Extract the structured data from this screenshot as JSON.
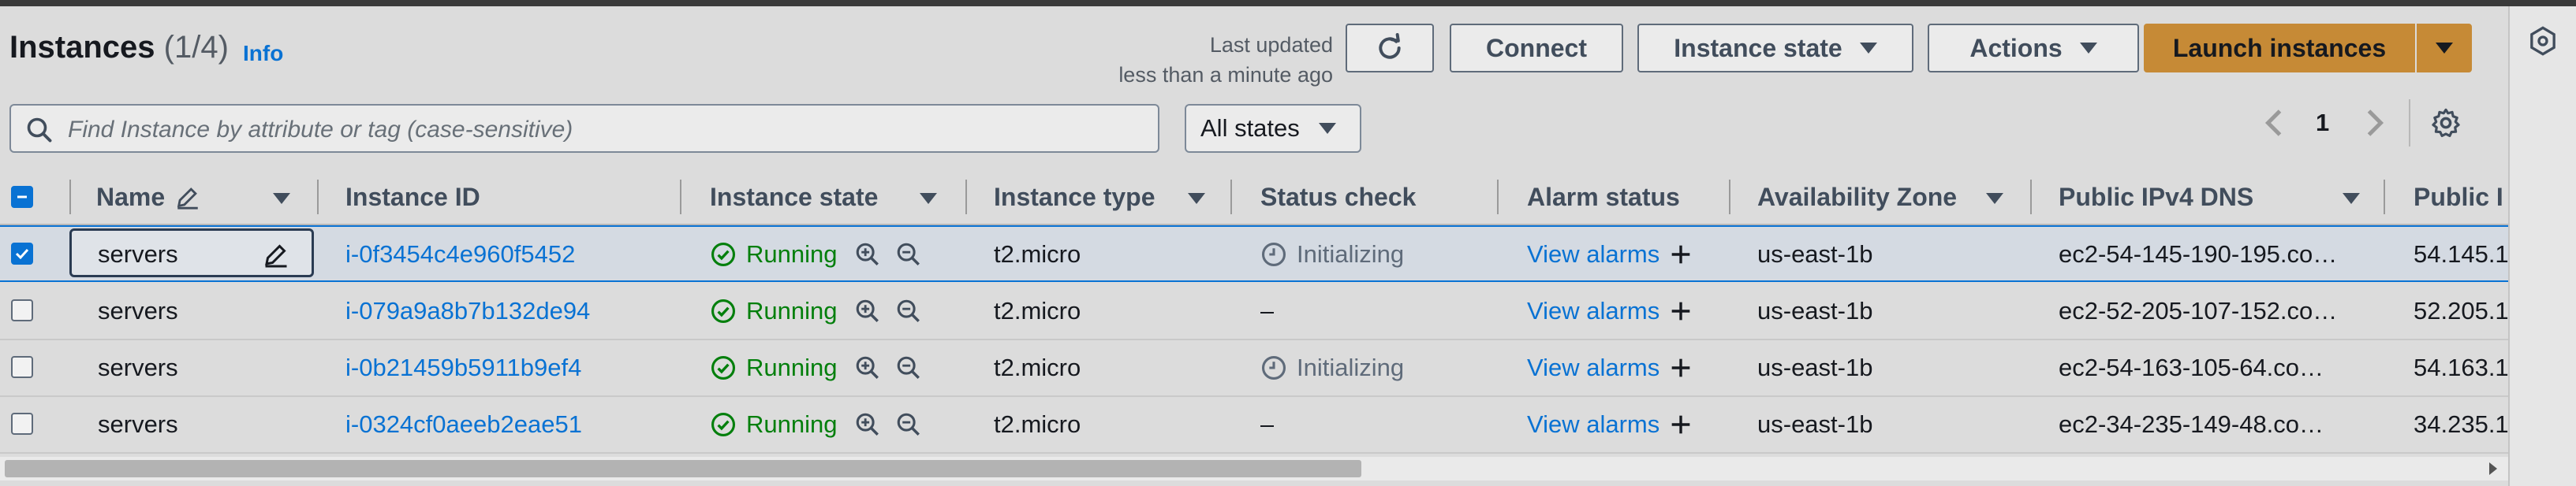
{
  "header": {
    "title": "Instances",
    "count": "(1/4)",
    "info": "Info",
    "last_updated_line1": "Last updated",
    "last_updated_line2": "less than a minute ago"
  },
  "toolbar": {
    "connect": "Connect",
    "instance_state": "Instance state",
    "actions": "Actions",
    "launch": "Launch instances"
  },
  "search": {
    "placeholder": "Find Instance by attribute or tag (case-sensitive)"
  },
  "filter": {
    "selected": "All states"
  },
  "pagination": {
    "page": "1"
  },
  "columns": [
    "Name",
    "Instance ID",
    "Instance state",
    "Instance type",
    "Status check",
    "Alarm status",
    "Availability Zone",
    "Public IPv4 DNS",
    "Public I"
  ],
  "rows": [
    {
      "name": "servers",
      "id": "i-0f3454c4e960f5452",
      "state": "Running",
      "type": "t2.micro",
      "status": "Initializing",
      "alarm": "View alarms",
      "az": "us-east-1b",
      "dns": "ec2-54-145-190-195.co…",
      "ip": "54.145.1"
    },
    {
      "name": "servers",
      "id": "i-079a9a8b7b132de94",
      "state": "Running",
      "type": "t2.micro",
      "status": "–",
      "alarm": "View alarms",
      "az": "us-east-1b",
      "dns": "ec2-52-205-107-152.co…",
      "ip": "52.205.1"
    },
    {
      "name": "servers",
      "id": "i-0b21459b5911b9ef4",
      "state": "Running",
      "type": "t2.micro",
      "status": "Initializing",
      "alarm": "View alarms",
      "az": "us-east-1b",
      "dns": "ec2-54-163-105-64.co…",
      "ip": "54.163.1"
    },
    {
      "name": "servers",
      "id": "i-0324cf0aeeb2eae51",
      "state": "Running",
      "type": "t2.micro",
      "status": "–",
      "alarm": "View alarms",
      "az": "us-east-1b",
      "dns": "ec2-34-235-149-48.co…",
      "ip": "34.235.1"
    }
  ],
  "colors": {
    "link": "#0972d3",
    "running": "#037f0c",
    "primary": "#c68a36"
  }
}
